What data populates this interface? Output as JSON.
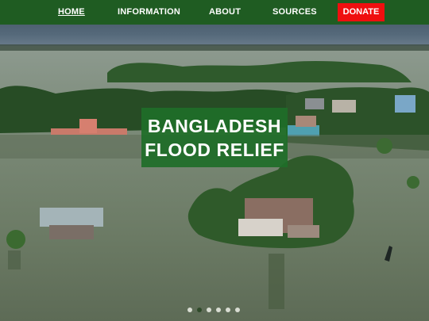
{
  "nav": {
    "items": [
      {
        "label": "HOME",
        "active": true
      },
      {
        "label": "INFORMATION",
        "active": false
      },
      {
        "label": "ABOUT",
        "active": false
      },
      {
        "label": "SOURCES",
        "active": false
      }
    ],
    "donate_label": "DONATE"
  },
  "hero": {
    "title_line1": "BANGLADESH",
    "title_line2": "FLOOD RELIEF"
  },
  "carousel": {
    "total": 6,
    "active_index": 1
  },
  "colors": {
    "nav_bg": "#1f5c22",
    "donate_bg": "#ef0f0f",
    "title_box_bg": "#1e6e28"
  }
}
